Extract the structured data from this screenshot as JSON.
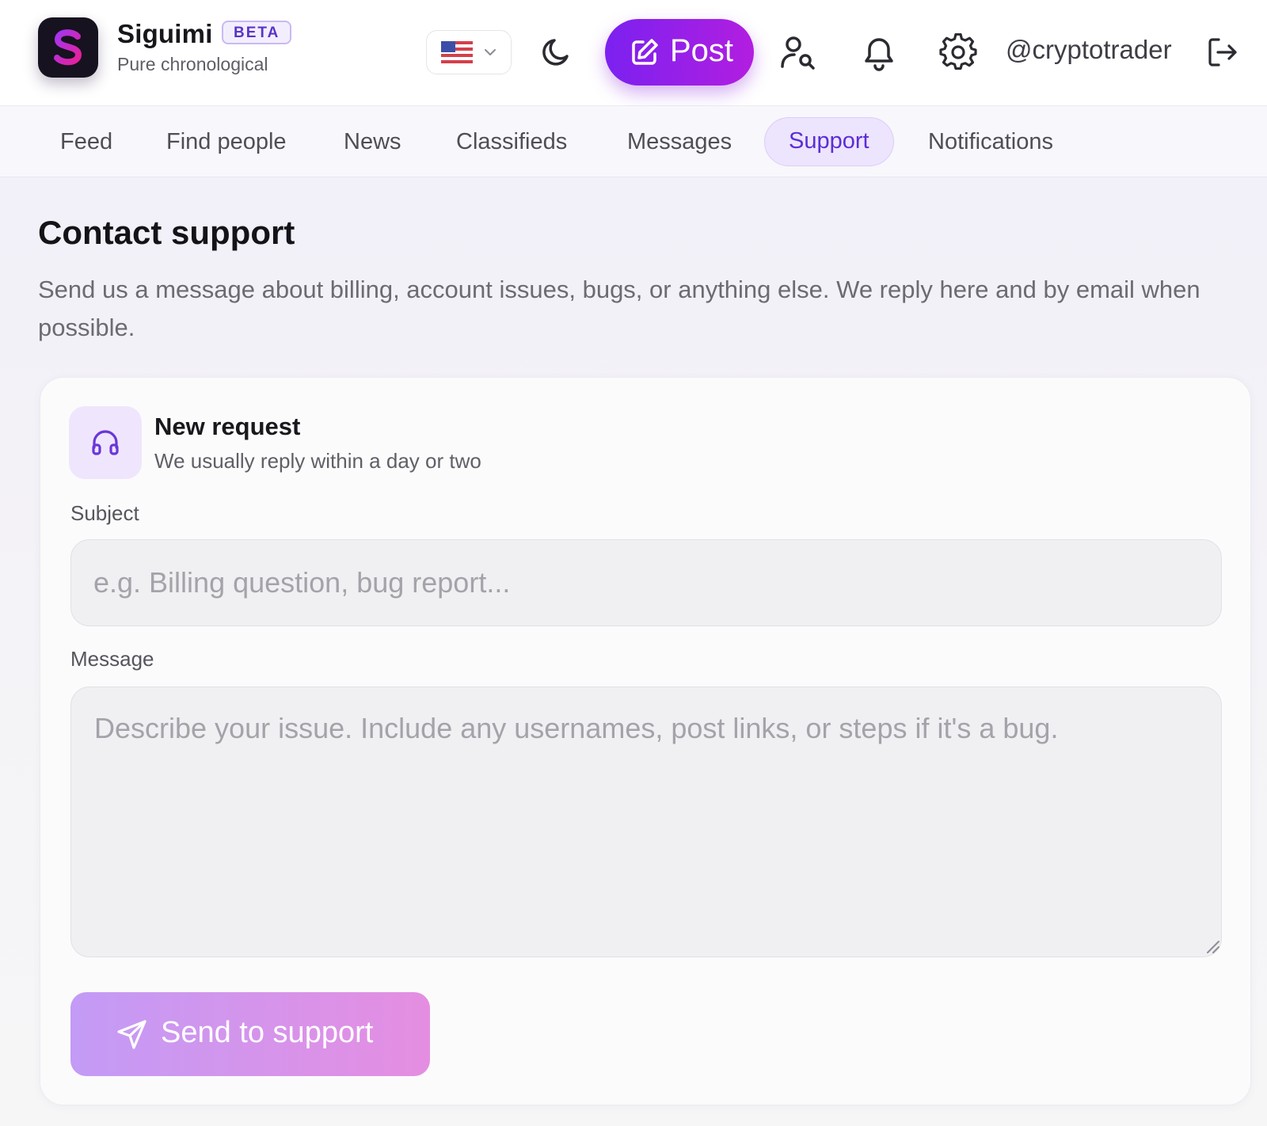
{
  "app": {
    "name": "Siguimi",
    "badge": "BETA",
    "tagline": "Pure chronological"
  },
  "header": {
    "language_flag": "us-flag-icon",
    "post_label": "Post",
    "username": "@cryptotrader"
  },
  "tabs": [
    {
      "label": "Feed",
      "active": false
    },
    {
      "label": "Find people",
      "active": false
    },
    {
      "label": "News",
      "active": false
    },
    {
      "label": "Classifieds",
      "active": false
    },
    {
      "label": "Messages",
      "active": false
    },
    {
      "label": "Support",
      "active": true
    },
    {
      "label": "Notifications",
      "active": false
    }
  ],
  "page": {
    "title": "Contact support",
    "description": "Send us a message about billing, account issues, bugs, or anything else. We reply here and by email when possible."
  },
  "form": {
    "title": "New request",
    "subtitle": "We usually reply within a day or two",
    "subject_label": "Subject",
    "subject_value": "",
    "subject_placeholder": "e.g. Billing question, bug report...",
    "message_label": "Message",
    "message_value": "",
    "message_placeholder": "Describe your issue. Include any usernames, post links, or steps if it's a bug.",
    "submit_label": "Send to support"
  },
  "colors": {
    "accent": "#7b21f0",
    "accent_end": "#b21ee0",
    "active_tab_bg": "#ede4fd",
    "active_tab_text": "#5b2ed6",
    "send_button_start": "#c39bf6",
    "send_button_end": "#e58ee1"
  }
}
